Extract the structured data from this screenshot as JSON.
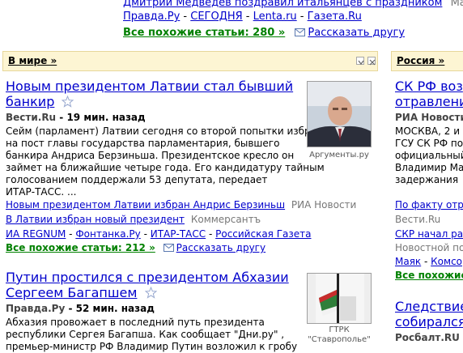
{
  "top": {
    "headline_cut": "Дмитрий Медведев поздравил итальянцев с праздником",
    "source_cut": "Маяк",
    "sources": [
      "Правда.Ру",
      "СЕГОДНЯ",
      "Lenta.ru",
      "Газета.Ru"
    ],
    "similar": "Все похожие статьи: 280 »",
    "tell_friend": "Рассказать другу"
  },
  "sections": {
    "world": {
      "title": "В мире »"
    },
    "russia": {
      "title": "Россия »"
    }
  },
  "world_news": [
    {
      "headline_l1": "Новым президентом Латвии стал бывший",
      "headline_l2": "банкир",
      "source": "Вести.Ru",
      "time": " - 19 мин. назад",
      "snippet": [
        "Сейм (парламент) Латвии сегодня со второй попытки избрал",
        "на пост главы государства парламентария, бывшего",
        "банкира Андриса Берзиньша. Президентское кресло он",
        "займет на ближайшие четыре года. Его кандидатуру тайным",
        "голосованием поддержали 53 депутата, передает",
        "ИТАР-ТАСС. ..."
      ],
      "photo_caption": "Аргументы.ру",
      "related": [
        {
          "title": "Новым президентом Латвии избран Андрис Берзиньш",
          "source": "РИА Новости"
        },
        {
          "title": "В Латвии избран новый президент",
          "source": "Коммерсантъ"
        }
      ],
      "more_sources": [
        "ИА REGNUM",
        "Фонтанка.Ру",
        "ИТАР-ТАСС",
        "Российская Газета"
      ],
      "similar": "Все похожие статьи: 212 »",
      "tell_friend": "Рассказать другу"
    },
    {
      "headline_l1": "Путин простился с президентом Абхазии",
      "headline_l2": "Сергеем Багапшем",
      "source": "Правда.Ру",
      "time": " - 52 мин. назад",
      "snippet": [
        "Абхазия провожает в последний путь президента",
        "республики Сергея Багапша. Как сообщает \"Дни.ру\" ,",
        "премьер-министр РФ Владимир Путин возложил к гробу"
      ],
      "photo_caption_l1": "ГТРК",
      "photo_caption_l2": "\"Ставрополье\""
    }
  ],
  "russia_news": {
    "headline_l1": "СК РФ воз",
    "headline_l2": "отравлени",
    "source": "РИА Новости",
    "lines": [
      "МОСКВА, 2 и",
      "ГСУ СК РФ по",
      "официальный",
      "Владимир Ма",
      "задержания"
    ],
    "fact_link": "По факту отра",
    "src2": "Вести.Ru",
    "skr_link": "СКР начал ра",
    "src3": "Новостной пор",
    "mayak": "Маяк",
    "komso": "Комсо",
    "similar_cut": "Все похожие",
    "headline2_l1": "Следствие",
    "headline2_l2": "собирался",
    "src4": "Росбалт.RU"
  },
  "colors": {
    "link": "#0000cc",
    "green": "#008000",
    "header_bg": "#fdf5d3"
  }
}
